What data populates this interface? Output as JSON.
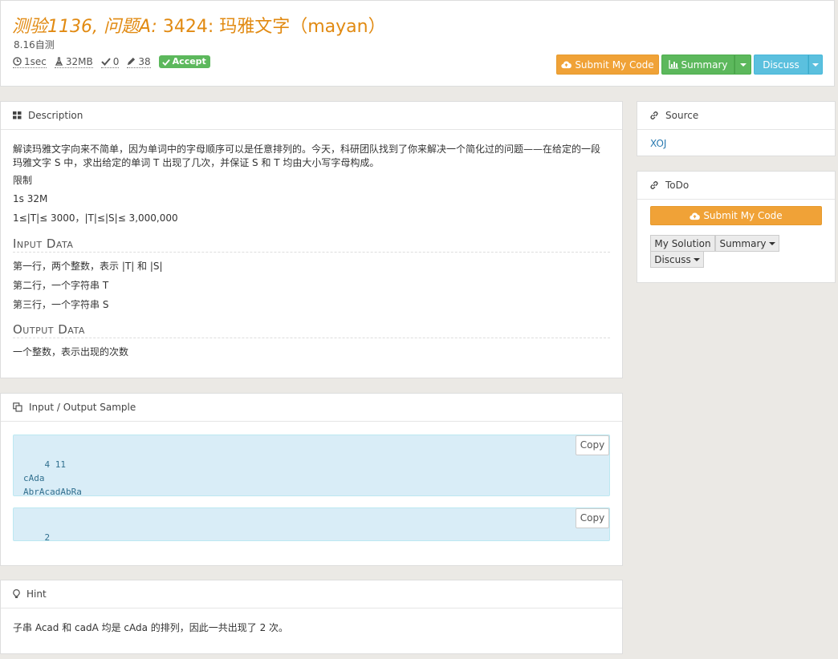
{
  "header": {
    "title_prefix": "测验1136, 问题A:",
    "title_main": " 3424: 玛雅文字（mayan）",
    "subtitle": "8.16自测",
    "time_limit": "1sec",
    "memory_limit": "32MB",
    "solved_count": "0",
    "submit_count": "38",
    "status_badge": "Accept"
  },
  "actions": {
    "submit_label": "Submit My Code",
    "summary_label": "Summary",
    "discuss_label": "Discuss"
  },
  "description": {
    "heading": "Description",
    "para1_line1": "解读玛雅文字向来不简单，因为单词中的字母顺序可以是任意排列的。今天，科研团队找到了你来解决一个简化过的问题——在给定的一段",
    "para1_line2": "玛雅文字 S 中，求出给定的单词 T 出现了几次，并保证 S 和 T 均由大小写字母构成。",
    "limit_title": "限制",
    "limit_1": "1s 32M",
    "limit_2": "1≤|T|≤ 3000，|T|≤|S|≤ 3,000,000",
    "input_heading": "Input Data",
    "input_line1": "第一行，两个整数，表示 |T| 和 |S|",
    "input_line2": "第二行，一个字符串 T",
    "input_line3": "第三行，一个字符串 S",
    "output_heading": "Output Data",
    "output_line1": "一个整数，表示出现的次数"
  },
  "sample": {
    "heading": "Input / Output Sample",
    "input_text": "4 11\ncAda\nAbrAcadAbRa",
    "output_text": "2",
    "copy_label": "Copy"
  },
  "hint": {
    "heading": "Hint",
    "text": "子串 Acad 和 cadA 均是 cAda 的排列，因此一共出现了 2 次。"
  },
  "source": {
    "heading": "Source",
    "link": "XOJ"
  },
  "todo": {
    "heading": "ToDo",
    "submit_label": "Submit My Code",
    "my_solution_label": "My Solution",
    "summary_label": "Summary",
    "discuss_label": "Discuss"
  },
  "colors": {
    "accent_orange": "#e18a12",
    "warning_button": "#f0a237",
    "success_button": "#5cb85c",
    "info_button": "#5bc0de",
    "code_background": "#d9edf7"
  },
  "icons": [
    "clock-icon",
    "flask-icon",
    "check-icon",
    "pencil-icon",
    "cloud-upload-icon",
    "bar-chart-icon",
    "grid-icon",
    "copy-icon",
    "lightbulb-icon",
    "link-icon"
  ]
}
